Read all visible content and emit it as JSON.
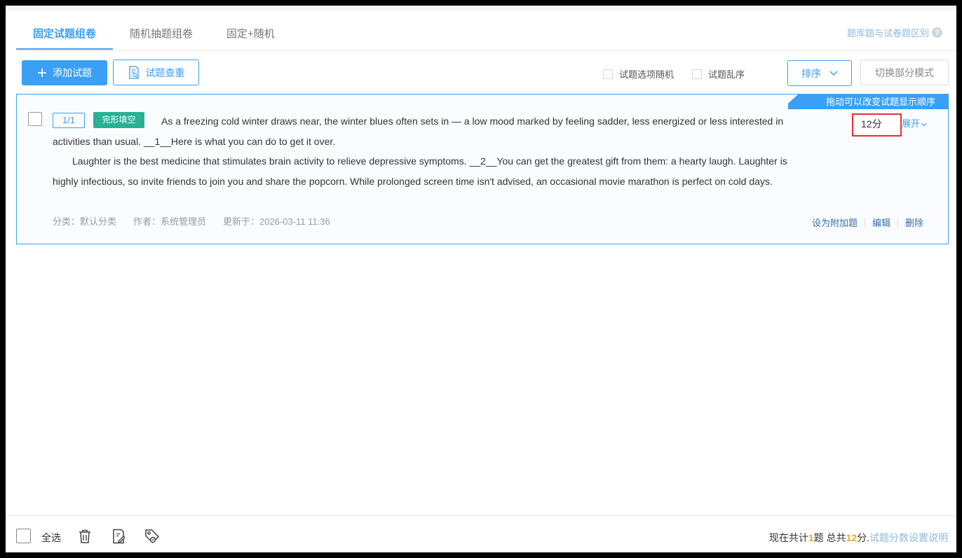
{
  "tabs": [
    "固定试题组卷",
    "随机抽题组卷",
    "固定+随机"
  ],
  "diff_link": "题库题与试卷题区别",
  "help_icon": "?",
  "toolbar": {
    "add_label": "添加试题",
    "check_label": "试题查重",
    "random_options_label": "试题选项随机",
    "shuffle_label": "试题乱序",
    "sort_label": "排序",
    "switch_label": "切换部分模式"
  },
  "question": {
    "drag_hint": "拖动可以改变试题显示顺序",
    "number": "1/1",
    "type": "完形填空",
    "para1": "As a freezing cold winter draws near, the winter blues often sets in — a low mood marked by feeling sadder, less energized or less interested in activities than usual. __1__Here is what you can do to get it over.",
    "para2": "Laughter is the best medicine that stimulates brain activity to relieve depressive symptoms. __2__You can get the greatest gift from them: a hearty laugh. Laughter is highly infectious, so invite friends to join you and share the popcorn. While prolonged screen time isn't advised, an occasional movie marathon is perfect on cold days.",
    "score": "12分",
    "expand": "展开",
    "category": "分类：默认分类",
    "author": "作者：系统管理员",
    "updated": "更新于：2026-03-11 11:36",
    "actions": {
      "extra": "设为附加题",
      "edit": "编辑",
      "delete": "删除"
    }
  },
  "footer": {
    "select_all": "全选",
    "summary_prefix": "现在共计",
    "count": "1",
    "summary_mid": "题 总共",
    "total": "12",
    "summary_suffix": "分.",
    "link": "试题分数设置说明"
  },
  "colors": {
    "accent": "#3a9ff5",
    "tag": "#28b194",
    "highlight": "#e5302f",
    "number": "#f5a623"
  }
}
